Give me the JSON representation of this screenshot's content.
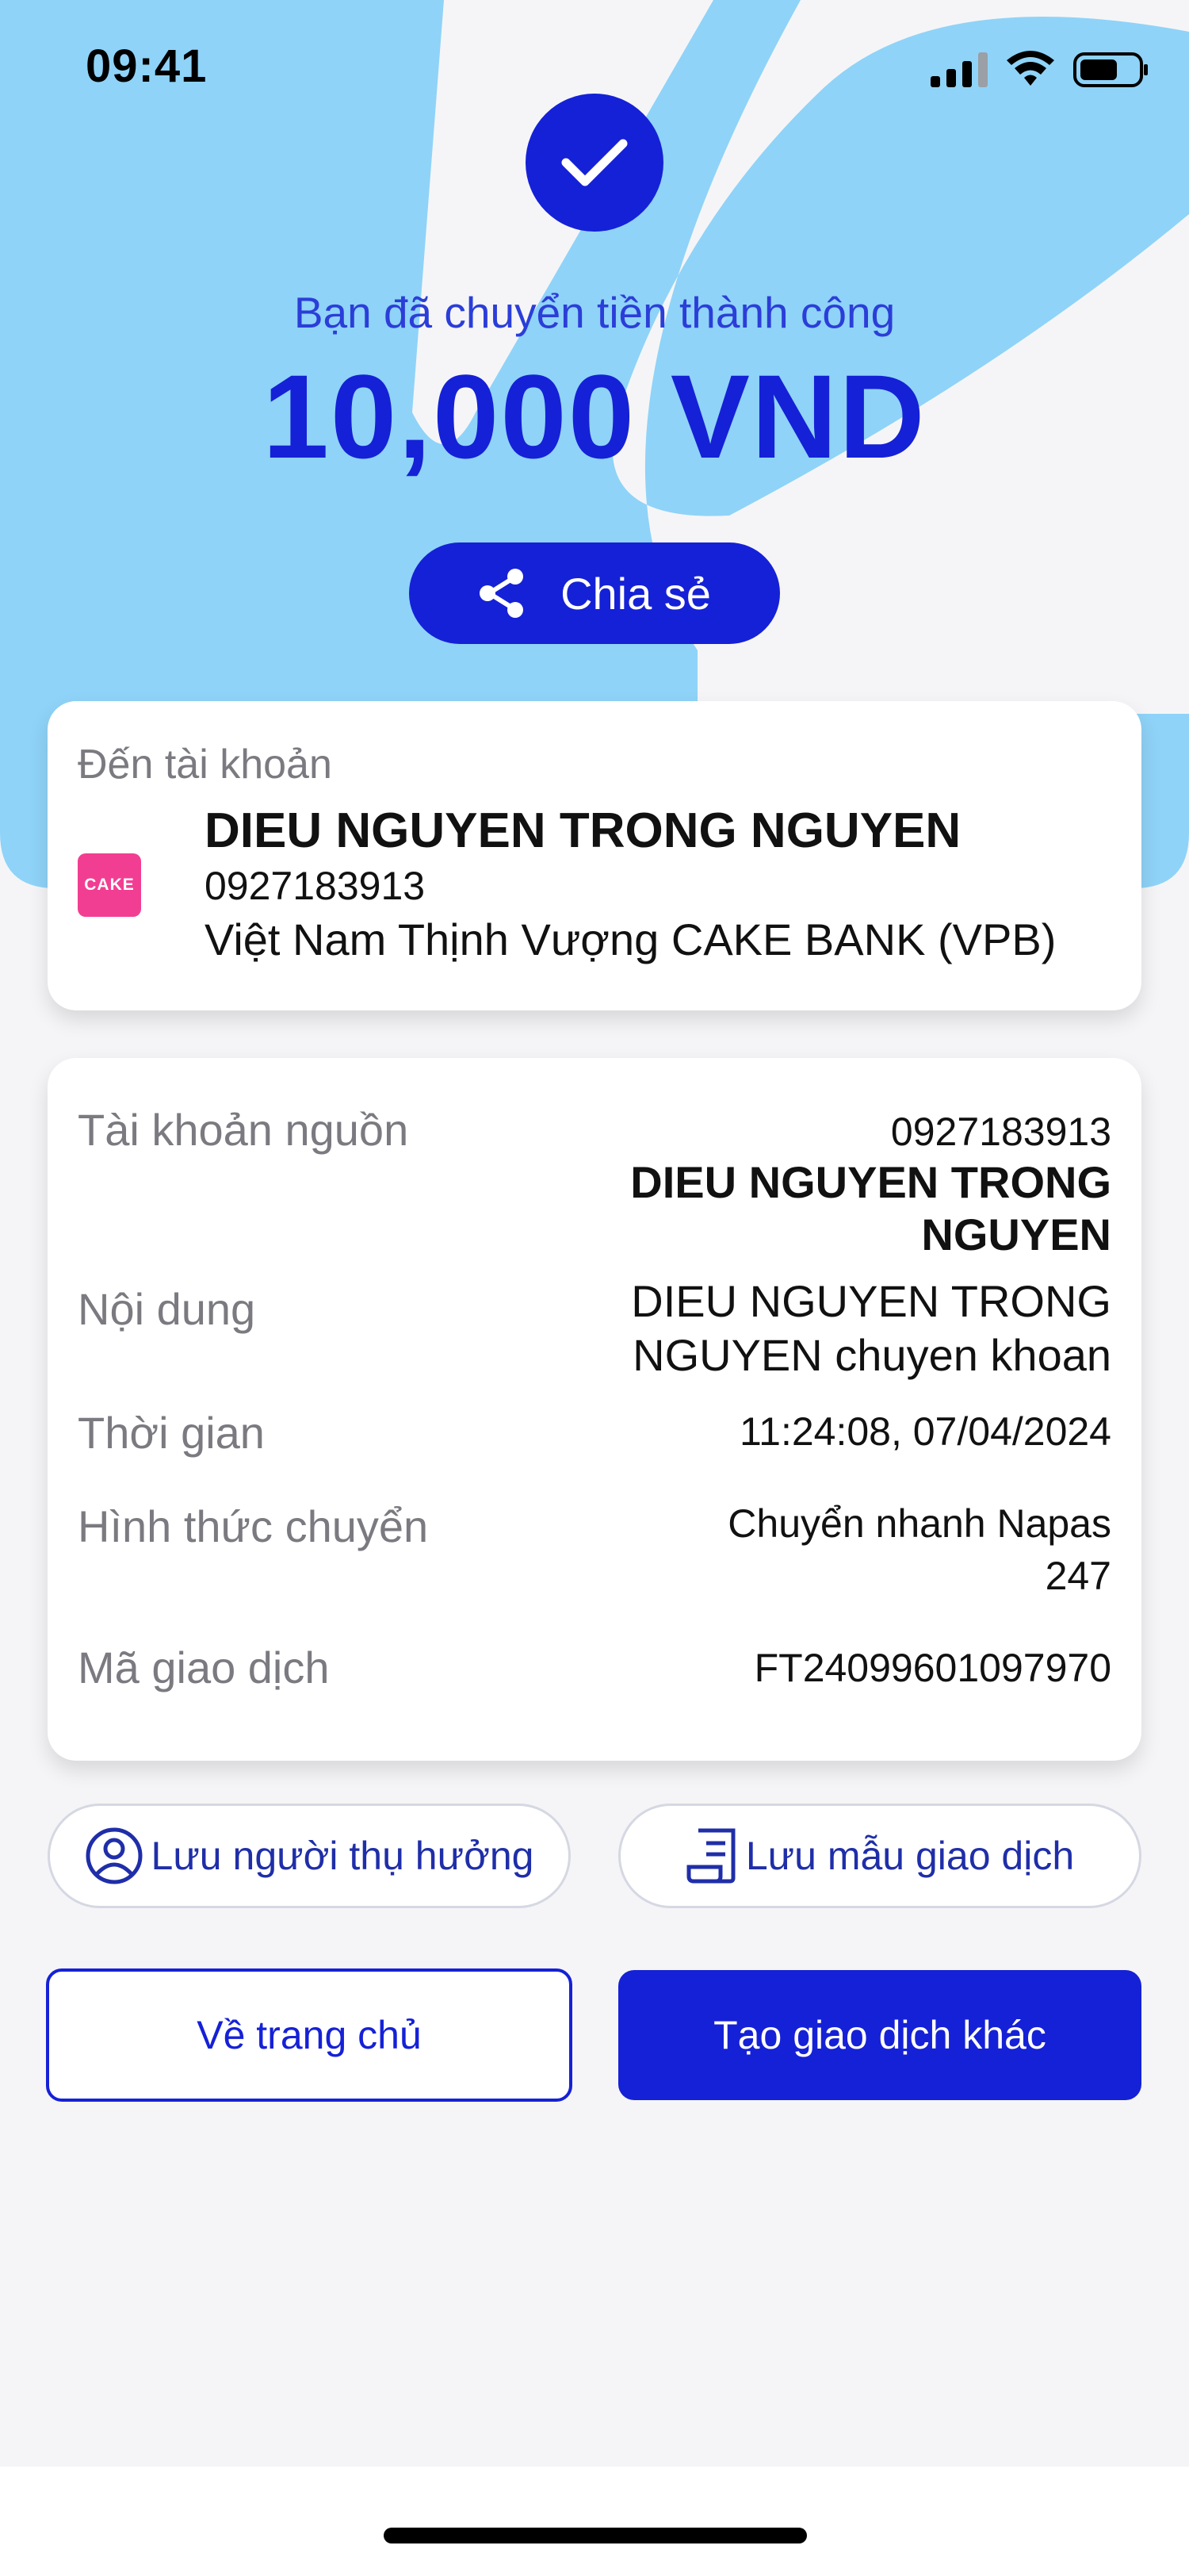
{
  "status_bar": {
    "time": "09:41"
  },
  "header": {
    "success_message": "Bạn đã chuyển tiền thành công",
    "amount": "10,000 VND",
    "share_label": "Chia sẻ"
  },
  "recipient": {
    "label": "Đến tài khoản",
    "bank_logo_text": "CAKE",
    "name": "DIEU NGUYEN TRONG NGUYEN",
    "account_number": "0927183913",
    "bank": "Việt Nam Thịnh Vượng CAKE BANK (VPB)"
  },
  "details": {
    "source_label": "Tài khoản nguồn",
    "source_account": "0927183913",
    "source_name_line1": "DIEU NGUYEN TRONG",
    "source_name_line2": "NGUYEN",
    "content_label": "Nội dung",
    "content_line1": "DIEU NGUYEN TRONG",
    "content_line2": "NGUYEN chuyen khoan",
    "time_label": "Thời gian",
    "time_value": "11:24:08, 07/04/2024",
    "method_label": "Hình thức chuyển",
    "method_line1": "Chuyển nhanh Napas",
    "method_line2": "247",
    "txn_label": "Mã giao dịch",
    "txn_value": "FT24099601097970"
  },
  "actions": {
    "save_beneficiary": "Lưu người thụ hưởng",
    "save_template": "Lưu mẫu giao dịch",
    "home": "Về trang chủ",
    "new_transaction": "Tạo giao dịch khác"
  },
  "colors": {
    "primary": "#1521d6",
    "background_light_blue": "#8fd3f8",
    "cake_pink": "#f23e92"
  }
}
